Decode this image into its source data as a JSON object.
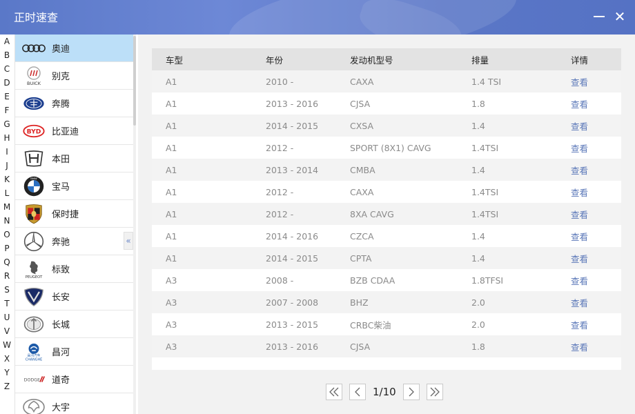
{
  "app": {
    "title": "正时速查"
  },
  "alphabet": [
    "A",
    "B",
    "C",
    "D",
    "E",
    "F",
    "G",
    "H",
    "I",
    "J",
    "K",
    "L",
    "M",
    "N",
    "O",
    "P",
    "Q",
    "R",
    "S",
    "T",
    "U",
    "V",
    "W",
    "X",
    "Y",
    "Z"
  ],
  "brands": [
    {
      "name": "奥迪"
    },
    {
      "name": "别克",
      "logo_text": "BUICK"
    },
    {
      "name": "奔腾"
    },
    {
      "name": "比亚迪",
      "logo_text": "BYD"
    },
    {
      "name": "本田"
    },
    {
      "name": "宝马",
      "logo_text": "BMW"
    },
    {
      "name": "保时捷"
    },
    {
      "name": "奔驰"
    },
    {
      "name": "标致",
      "logo_text": "PEUGEOT"
    },
    {
      "name": "长安"
    },
    {
      "name": "长城"
    },
    {
      "name": "昌河",
      "logo_text": "CHANGHE"
    },
    {
      "name": "道奇",
      "logo_text": "DODGE"
    },
    {
      "name": "大宇"
    }
  ],
  "table": {
    "headers": [
      "车型",
      "年份",
      "发动机型号",
      "排量",
      "详情"
    ],
    "rows": [
      [
        "A1",
        "2010 -",
        "CAXA",
        "1.4 TSI",
        "查看"
      ],
      [
        "A1",
        "2013 - 2016",
        "CJSA",
        "1.8",
        "查看"
      ],
      [
        "A1",
        "2014 - 2015",
        "CXSA",
        "1.4",
        "查看"
      ],
      [
        "A1",
        "2012 -",
        "SPORT (8X1) CAVG",
        "1.4TSI",
        "查看"
      ],
      [
        "A1",
        "2013 - 2014",
        "CMBA",
        "1.4",
        "查看"
      ],
      [
        "A1",
        "2012 -",
        "CAXA",
        "1.4TSI",
        "查看"
      ],
      [
        "A1",
        "2012 -",
        "8XA CAVG",
        "1.4TSI",
        "查看"
      ],
      [
        "A1",
        "2014 - 2016",
        "CZCA",
        "1.4",
        "查看"
      ],
      [
        "A1",
        "2014 - 2015",
        "CPTA",
        "1.4",
        "查看"
      ],
      [
        "A3",
        "2008 -",
        "BZB CDAA",
        "1.8TFSI",
        "查看"
      ],
      [
        "A3",
        "2007 - 2008",
        "BHZ",
        "2.0",
        "查看"
      ],
      [
        "A3",
        "2013 - 2015",
        "CRBC柴油",
        "2.0",
        "查看"
      ],
      [
        "A3",
        "2013 - 2016",
        "CJSA",
        "1.8",
        "查看"
      ]
    ]
  },
  "pager": {
    "text": "1/10"
  },
  "colors": {
    "title_bar": "#5a78c8",
    "selected_brand": "#bcdff8",
    "link": "#5a77b8"
  }
}
